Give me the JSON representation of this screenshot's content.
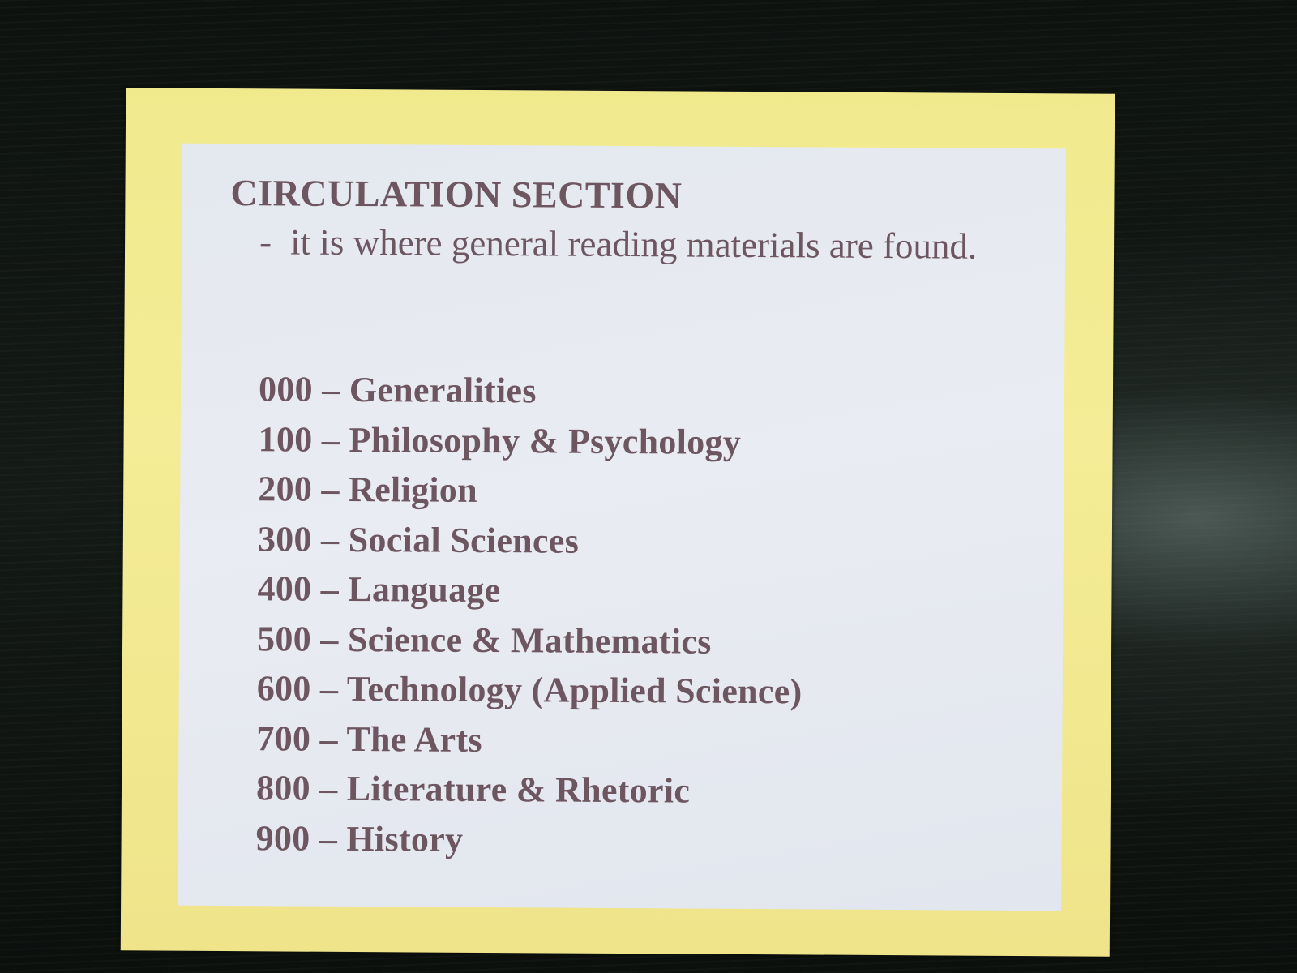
{
  "sign": {
    "heading": "CIRCULATION SECTION",
    "description_dash": "-",
    "description": "it is where general reading materials are found.",
    "classes": [
      {
        "code": "000",
        "label": "Generalities"
      },
      {
        "code": "100",
        "label": "Philosophy & Psychology"
      },
      {
        "code": "200",
        "label": "Religion"
      },
      {
        "code": "300",
        "label": "Social Sciences"
      },
      {
        "code": "400",
        "label": "Language"
      },
      {
        "code": "500",
        "label": "Science & Mathematics"
      },
      {
        "code": "600",
        "label": "Technology (Applied Science)"
      },
      {
        "code": "700",
        "label": "The Arts"
      },
      {
        "code": "800",
        "label": "Literature & Rhetoric"
      },
      {
        "code": "900",
        "label": "History"
      }
    ],
    "separator": "–",
    "colors": {
      "text": "#6e5660",
      "paper": "#e6eaf0",
      "mat": "#f2ea90",
      "board": "#0f1411"
    }
  }
}
